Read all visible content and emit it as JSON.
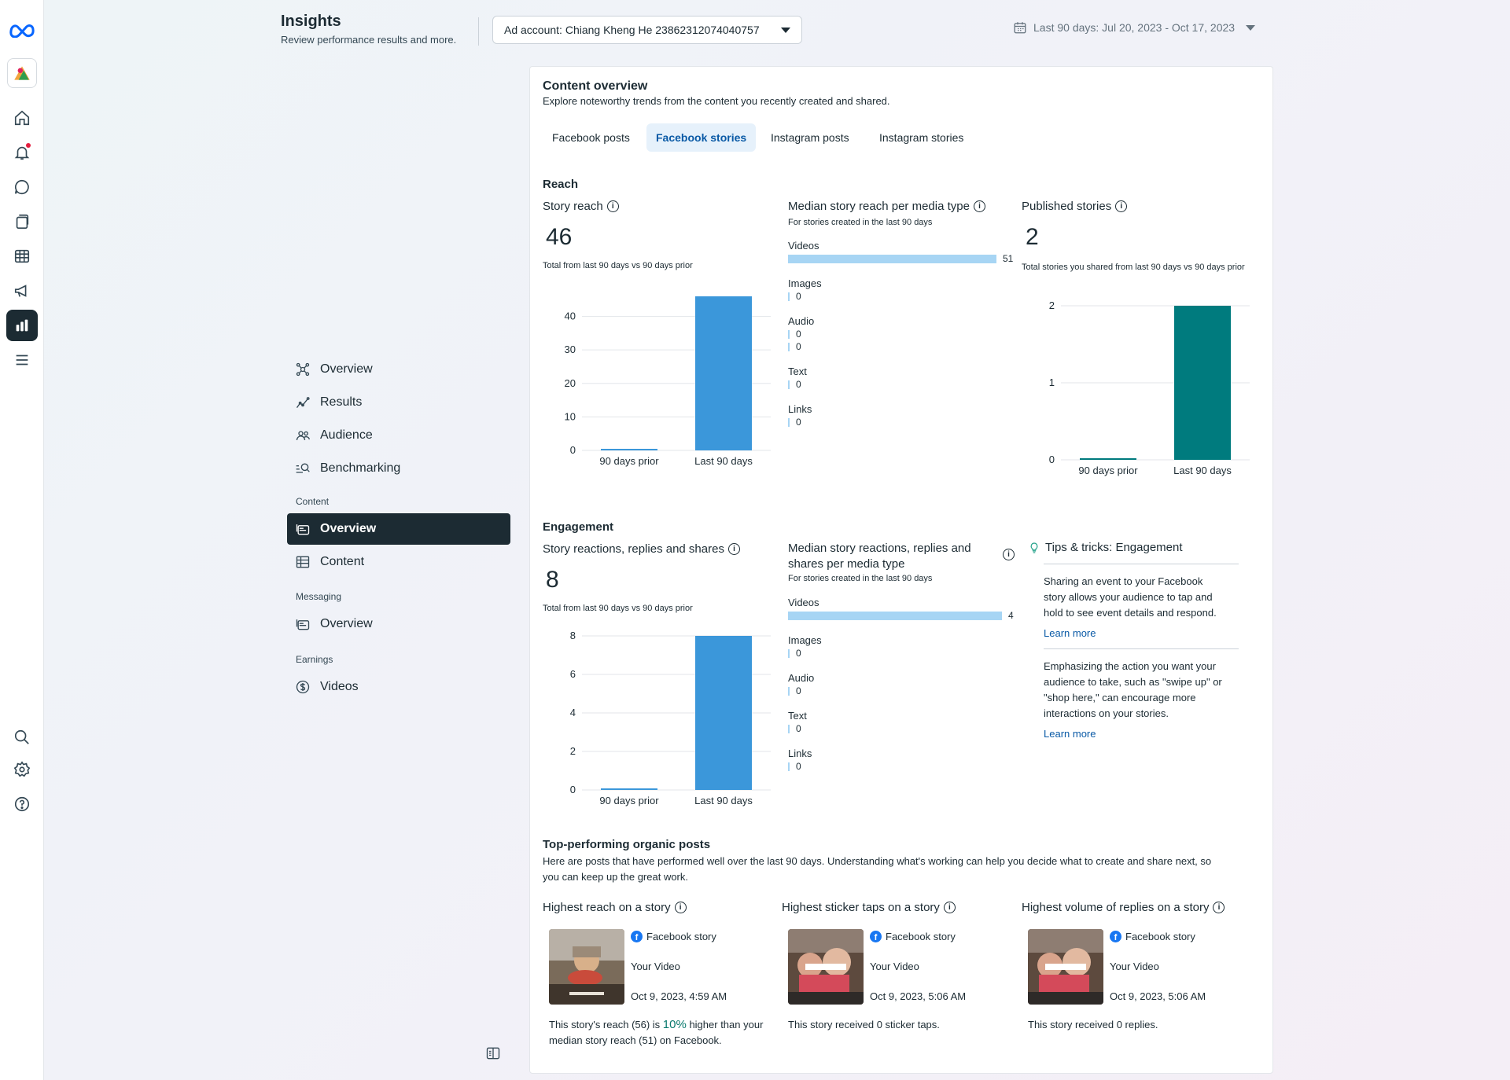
{
  "header": {
    "title": "Insights",
    "subtitle": "Review performance results and more.",
    "ad_account": "Ad account: Chiang Kheng He 2386231207404075​7",
    "date_range": "Last 90 days: Jul 20, 2023 - Oct 17, 2023"
  },
  "rail": {
    "icons": [
      "meta-logo-icon",
      "account-avatar-icon",
      "home-icon",
      "notifications-icon",
      "messages-icon",
      "pages-icon",
      "table-icon",
      "ads-icon",
      "insights-icon",
      "menu-icon",
      "search-icon",
      "settings-icon",
      "help-icon"
    ]
  },
  "nav": {
    "overview": "Overview",
    "results": "Results",
    "audience": "Audience",
    "benchmarking": "Benchmarking",
    "content_section": "Content",
    "content_overview": "Overview",
    "content": "Content",
    "messaging_section": "Messaging",
    "messaging_overview": "Overview",
    "earnings_section": "Earnings",
    "videos": "Videos"
  },
  "content_overview": {
    "title": "Content overview",
    "subtitle": "Explore noteworthy trends from the content you recently created and shared.",
    "tabs": [
      "Facebook posts",
      "Facebook stories",
      "Instagram posts",
      "Instagram stories"
    ],
    "active_tab": "Facebook stories"
  },
  "reach": {
    "title": "Reach",
    "story_reach": {
      "label": "Story reach",
      "value": "46",
      "note": "Total from last 90 days vs 90 days prior"
    },
    "median": {
      "label": "Median story reach per media type",
      "note": "For stories created in the last 90 days",
      "rows": [
        {
          "name": "Videos",
          "value": "51"
        },
        {
          "name": "Images",
          "value": "0"
        },
        {
          "name": "Audio",
          "value": "0",
          "value2": "0"
        },
        {
          "name": "Text",
          "value": "0"
        },
        {
          "name": "Links",
          "value": "0"
        }
      ]
    },
    "published": {
      "label": "Published stories",
      "value": "2",
      "note": "Total stories you shared from last 90 days vs 90 days prior"
    }
  },
  "engagement": {
    "title": "Engagement",
    "reactions": {
      "label": "Story reactions, replies and shares",
      "value": "8",
      "note": "Total from last 90 days vs 90 days prior"
    },
    "median": {
      "label_line1": "Median story reactions, replies and",
      "label_line2": "shares per media type",
      "note": "For stories created in the last 90 days",
      "rows": [
        {
          "name": "Videos",
          "value": "4"
        },
        {
          "name": "Images",
          "value": "0"
        },
        {
          "name": "Audio",
          "value": "0"
        },
        {
          "name": "Text",
          "value": "0"
        },
        {
          "name": "Links",
          "value": "0"
        }
      ]
    },
    "tips": {
      "title": "Tips & tricks: Engagement",
      "tip1": [
        "Sharing an event to your Facebook",
        "story allows your audience to tap and",
        "hold to see event details and respond."
      ],
      "tip2": [
        "Emphasizing the action you want your",
        "audience to take, such as \"swipe up\" or",
        "\"shop here,\" can encourage more",
        "interactions on your stories."
      ],
      "learn_more": "Learn more"
    }
  },
  "top_posts": {
    "title": "Top-performing organic posts",
    "subtitle_line1": "Here are posts that have performed well over the last 90 days. Understanding what's working can help you decide what to create and share next, so",
    "subtitle_line2": "you can keep up the great work.",
    "cards": [
      {
        "heading": "Highest reach on a story",
        "source": "Facebook story",
        "name": "Your Video",
        "date": "Oct 9, 2023, 4:59 AM",
        "desc_pre": "This story's reach (56) is ",
        "desc_hl": "10%",
        "desc_post": " higher than your",
        "desc_line2": "median story reach (51) on Facebook."
      },
      {
        "heading": "Highest sticker taps on a story",
        "source": "Facebook story",
        "name": "Your Video",
        "date": "Oct 9, 2023, 5:06 AM",
        "desc": "This story received 0 sticker taps."
      },
      {
        "heading": "Highest volume of replies on a story",
        "source": "Facebook story",
        "name": "Your Video",
        "date": "Oct 9, 2023, 5:06 AM",
        "desc": "This story received 0 replies."
      }
    ]
  },
  "chart_data": [
    {
      "type": "bar",
      "title": "Story reach",
      "categories": [
        "90 days prior",
        "Last 90 days"
      ],
      "values": [
        0,
        46
      ],
      "yticks": [
        0,
        10,
        20,
        30,
        40
      ],
      "ylim": [
        0,
        46
      ],
      "color": "#3b97da"
    },
    {
      "type": "bar",
      "title": "Published stories",
      "categories": [
        "90 days prior",
        "Last 90 days"
      ],
      "values": [
        0,
        2
      ],
      "yticks": [
        0,
        1,
        2
      ],
      "ylim": [
        0,
        2
      ],
      "color": "#007b7e"
    },
    {
      "type": "bar",
      "title": "Story reactions, replies and shares",
      "categories": [
        "90 days prior",
        "Last 90 days"
      ],
      "values": [
        0,
        8
      ],
      "yticks": [
        0,
        2,
        4,
        6,
        8
      ],
      "ylim": [
        0,
        8
      ],
      "color": "#3b97da"
    },
    {
      "type": "bar",
      "title": "Median story reach per media type",
      "categories": [
        "Videos",
        "Images",
        "Audio",
        "Text",
        "Links"
      ],
      "values": [
        51,
        0,
        0,
        0,
        0
      ],
      "color": "#a7d5f4"
    },
    {
      "type": "bar",
      "title": "Median story reactions, replies and shares per media type",
      "categories": [
        "Videos",
        "Images",
        "Audio",
        "Text",
        "Links"
      ],
      "values": [
        4,
        0,
        0,
        0,
        0
      ],
      "color": "#a7d5f4"
    }
  ]
}
